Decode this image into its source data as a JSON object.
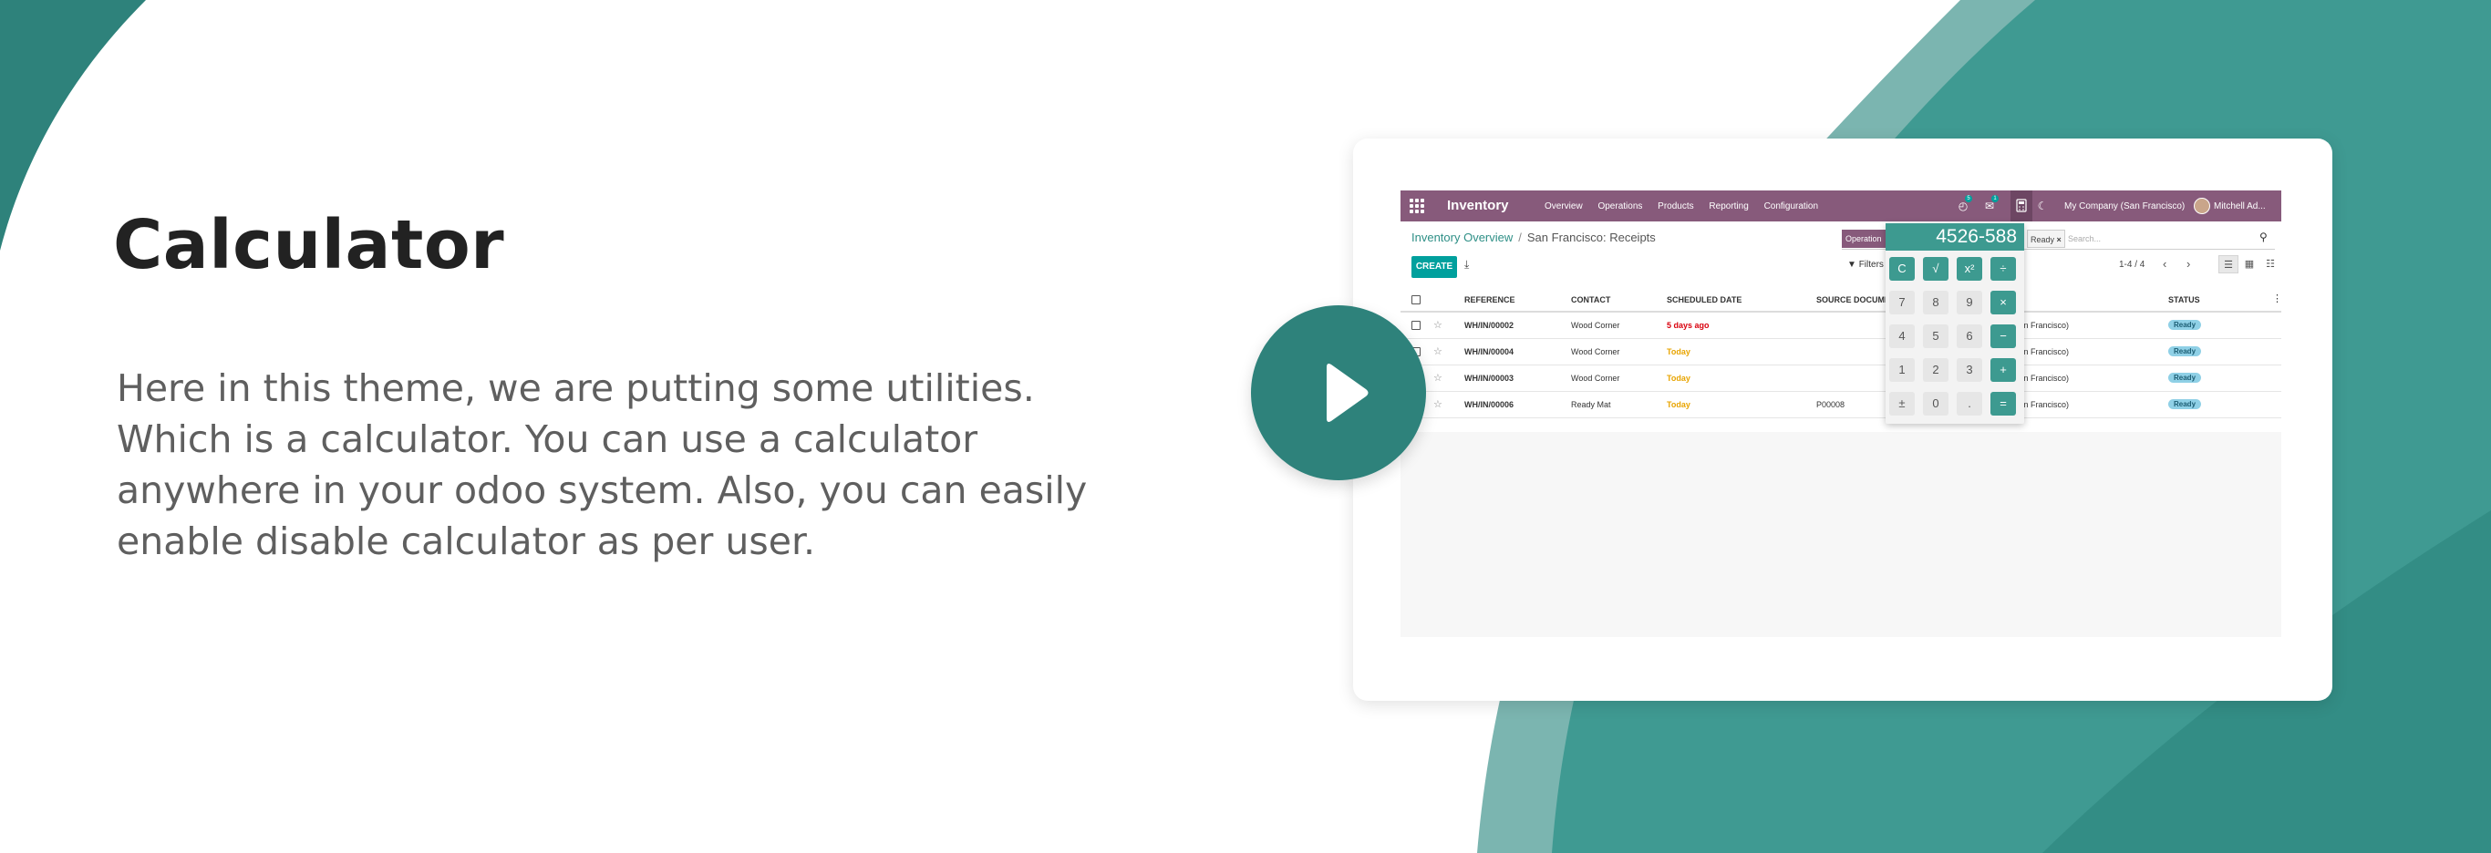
{
  "hero": {
    "title": "Calculator",
    "description": "Here in this theme, we are putting some utilities. Which is a calculator. You can use a calculator anywhere in your odoo system. Also, you can easily enable disable calculator as per user."
  },
  "colors": {
    "teal_primary": "#2e827b",
    "teal_light": "#6aaea8",
    "navbar": "#875a7b",
    "calculator_accent": "#3d9a90"
  },
  "navbar": {
    "brand": "Inventory",
    "menu": [
      "Overview",
      "Operations",
      "Products",
      "Reporting",
      "Configuration"
    ],
    "badges": {
      "activity": "5",
      "messages": "1"
    },
    "company": "My Company (San Francisco)",
    "user": "Mitchell Ad..."
  },
  "breadcrumb": {
    "parent": "Inventory Overview",
    "separator": "/",
    "current": "San Francisco: Receipts"
  },
  "toolbar": {
    "create_label": "CREATE",
    "filters_label": "Filters",
    "pager": "1-4 / 4",
    "search_facet_operation": "Operation",
    "search_facet_ready": "Ready",
    "search_placeholder": "Search..."
  },
  "calculator": {
    "display": "4526-588",
    "keys": [
      [
        "C",
        "√",
        "x²",
        "÷"
      ],
      [
        "7",
        "8",
        "9",
        "×"
      ],
      [
        "4",
        "5",
        "6",
        "−"
      ],
      [
        "1",
        "2",
        "3",
        "+"
      ],
      [
        "±",
        "0",
        ".",
        "="
      ]
    ]
  },
  "table": {
    "headers": {
      "reference": "REFERENCE",
      "contact": "CONTACT",
      "scheduled": "SCHEDULED DATE",
      "source": "SOURCE DOCUME",
      "status": "STATUS"
    },
    "rows": [
      {
        "reference": "WH/IN/00002",
        "contact": "Wood Corner",
        "scheduled": "5 days ago",
        "source": "",
        "destination": "r (San Francisco)",
        "status": "Ready"
      },
      {
        "reference": "WH/IN/00004",
        "contact": "Wood Corner",
        "scheduled": "Today",
        "source": "",
        "destination": "r (San Francisco)",
        "status": "Ready"
      },
      {
        "reference": "WH/IN/00003",
        "contact": "Wood Corner",
        "scheduled": "Today",
        "source": "",
        "destination": "r (San Francisco)",
        "status": "Ready"
      },
      {
        "reference": "WH/IN/00006",
        "contact": "Ready Mat",
        "scheduled": "Today",
        "source": "P00008",
        "destination": "r (San Francisco)",
        "status": "Ready"
      }
    ]
  },
  "icons": {
    "play": "play-icon",
    "apps": "apps-grid-icon",
    "calculator": "calculator-icon",
    "theme": "moon-icon",
    "search": "search-icon"
  }
}
